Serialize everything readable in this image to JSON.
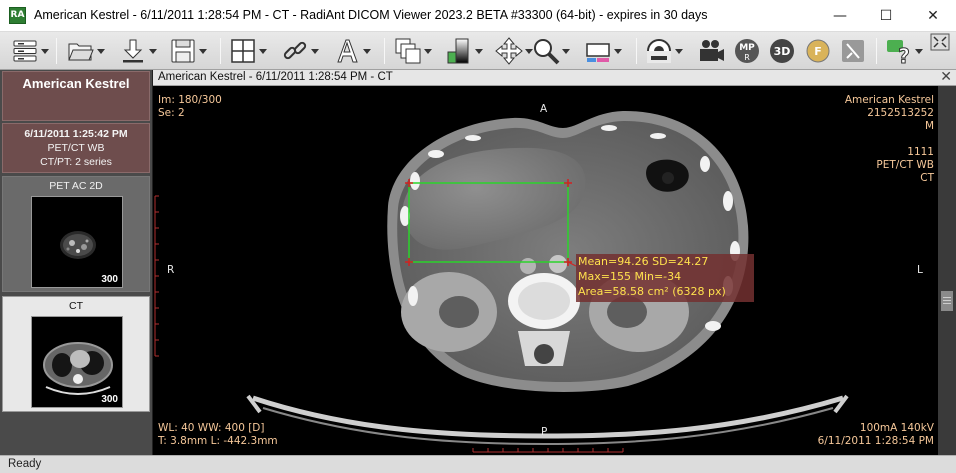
{
  "window": {
    "title": "American Kestrel - 6/11/2011 1:28:54 PM - CT - RadiAnt DICOM Viewer 2023.2 BETA #33300 (64-bit) - expires in 30 days",
    "app_icon_text": "RA",
    "minimize": "—",
    "maximize": "☐",
    "close": "✕"
  },
  "toolbar": {
    "tools": [
      "menu",
      "open",
      "download",
      "save",
      "layout",
      "link-series",
      "annotation-text",
      "series-stack",
      "window-level",
      "pan",
      "zoom",
      "roi-rectangle",
      "mpr-tool",
      "video",
      "mpr",
      "3d-vr",
      "fusion",
      "export",
      "help"
    ]
  },
  "study": {
    "patient_name": "American Kestrel",
    "date": "6/11/2011 1:25:42 PM",
    "description": "PET/CT WB",
    "modality_count": "CT/PT: 2 series"
  },
  "series": [
    {
      "name": "PET AC 2D",
      "count": "300"
    },
    {
      "name": "CT",
      "count": "300"
    }
  ],
  "viewer": {
    "title": "American Kestrel - 6/11/2011 1:28:54 PM - CT",
    "close": "✕",
    "overlay": {
      "image_index": "Im: 180/300",
      "series_index": "Se: 2",
      "patient_name": "American Kestrel",
      "patient_id": "2152513252",
      "sex": "M",
      "study_id": "1111",
      "study_desc": "PET/CT WB",
      "modality": "CT",
      "orient_top": "A",
      "orient_bottom": "P",
      "orient_left": "R",
      "orient_right": "L",
      "window": "WL: 40 WW: 400 [D]",
      "thickness_loc": "T: 3.8mm L: -442.3mm",
      "exposure": "100mA 140kV",
      "acq_time": "6/11/2011 1:28:54 PM"
    },
    "roi_stats": {
      "line1": "Mean=94.26 SD=24.27",
      "line2": "Max=155 Min=-34",
      "line3": "Area=58.58 cm² (6328 px)"
    }
  },
  "status": {
    "text": "Ready"
  },
  "colors": {
    "overlay_text": "#f6c89a",
    "roi_text": "#ffe14d",
    "roi_line": "#2bd42b",
    "study_header": "#6e4d4d"
  }
}
